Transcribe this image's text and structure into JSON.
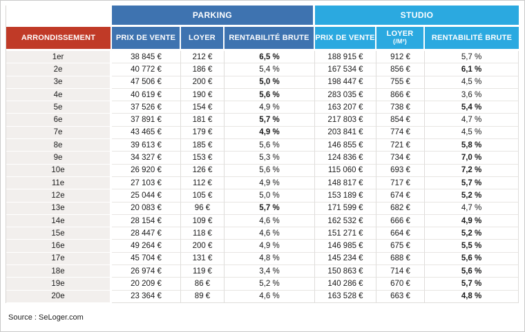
{
  "source": "Source : SeLoger.com",
  "colors": {
    "parking_header": "#3E73B0",
    "studio_header": "#2BA9E0",
    "arrondissement_header": "#C03A27",
    "row_label_background": "#F2EFED",
    "grid_line": "#DEDCDA",
    "text": "#1A1A1A"
  },
  "table": {
    "groups": {
      "parking": "PARKING",
      "studio": "STUDIO"
    },
    "headers": {
      "arrondissement": "ARRONDISSEMENT",
      "parking_prix": "PRIX DE VENTE",
      "parking_loyer": "LOYER",
      "parking_rent": "RENTABILITÉ BRUTE",
      "studio_prix": "PRIX DE VENTE",
      "studio_loyer_line1": "LOYER",
      "studio_loyer_line2": "(/M²)",
      "studio_rent": "RENTABILITÉ BRUTE"
    },
    "rows": [
      {
        "arr": "1er",
        "parking": {
          "prix": "38 845 €",
          "loyer": "212 €",
          "rent": "6,5 %",
          "rent_bold": true
        },
        "studio": {
          "prix": "188 915 €",
          "loyer": "912 €",
          "rent": "5,7 %",
          "rent_bold": false
        }
      },
      {
        "arr": "2e",
        "parking": {
          "prix": "40 772 €",
          "loyer": "186 €",
          "rent": "5,4 %",
          "rent_bold": false
        },
        "studio": {
          "prix": "167 534 €",
          "loyer": "856 €",
          "rent": "6,1 %",
          "rent_bold": true
        }
      },
      {
        "arr": "3e",
        "parking": {
          "prix": "47 506 €",
          "loyer": "200 €",
          "rent": "5,0 %",
          "rent_bold": true
        },
        "studio": {
          "prix": "198 447 €",
          "loyer": "755 €",
          "rent": "4,5 %",
          "rent_bold": false
        }
      },
      {
        "arr": "4e",
        "parking": {
          "prix": "40 619 €",
          "loyer": "190 €",
          "rent": "5,6 %",
          "rent_bold": true
        },
        "studio": {
          "prix": "283 035 €",
          "loyer": "866 €",
          "rent": "3,6 %",
          "rent_bold": false
        }
      },
      {
        "arr": "5e",
        "parking": {
          "prix": "37 526 €",
          "loyer": "154 €",
          "rent": "4,9 %",
          "rent_bold": false
        },
        "studio": {
          "prix": "163 207 €",
          "loyer": "738 €",
          "rent": "5,4 %",
          "rent_bold": true
        }
      },
      {
        "arr": "6e",
        "parking": {
          "prix": "37 891 €",
          "loyer": "181 €",
          "rent": "5,7 %",
          "rent_bold": true
        },
        "studio": {
          "prix": "217 803 €",
          "loyer": "854 €",
          "rent": "4,7 %",
          "rent_bold": false
        }
      },
      {
        "arr": "7e",
        "parking": {
          "prix": "43 465 €",
          "loyer": "179 €",
          "rent": "4,9 %",
          "rent_bold": true
        },
        "studio": {
          "prix": "203 841 €",
          "loyer": "774 €",
          "rent": "4,5 %",
          "rent_bold": false
        }
      },
      {
        "arr": "8e",
        "parking": {
          "prix": "39 613 €",
          "loyer": "185 €",
          "rent": "5,6 %",
          "rent_bold": false
        },
        "studio": {
          "prix": "146 855 €",
          "loyer": "721 €",
          "rent": "5,8 %",
          "rent_bold": true
        }
      },
      {
        "arr": "9e",
        "parking": {
          "prix": "34 327 €",
          "loyer": "153 €",
          "rent": "5,3 %",
          "rent_bold": false
        },
        "studio": {
          "prix": "124 836 €",
          "loyer": "734 €",
          "rent": "7,0 %",
          "rent_bold": true
        }
      },
      {
        "arr": "10e",
        "parking": {
          "prix": "26 920 €",
          "loyer": "126 €",
          "rent": "5,6 %",
          "rent_bold": false
        },
        "studio": {
          "prix": "115 060 €",
          "loyer": "693 €",
          "rent": "7,2 %",
          "rent_bold": true
        }
      },
      {
        "arr": "11e",
        "parking": {
          "prix": "27 103 €",
          "loyer": "112 €",
          "rent": "4,9 %",
          "rent_bold": false
        },
        "studio": {
          "prix": "148 817 €",
          "loyer": "717 €",
          "rent": "5,7 %",
          "rent_bold": true
        }
      },
      {
        "arr": "12e",
        "parking": {
          "prix": "25 044 €",
          "loyer": "105 €",
          "rent": "5,0 %",
          "rent_bold": false
        },
        "studio": {
          "prix": "153 189 €",
          "loyer": "674 €",
          "rent": "5,2 %",
          "rent_bold": true
        }
      },
      {
        "arr": "13e",
        "parking": {
          "prix": "20 083 €",
          "loyer": "96 €",
          "rent": "5,7 %",
          "rent_bold": true
        },
        "studio": {
          "prix": "171 599 €",
          "loyer": "682 €",
          "rent": "4,7 %",
          "rent_bold": false
        }
      },
      {
        "arr": "14e",
        "parking": {
          "prix": "28 154 €",
          "loyer": "109 €",
          "rent": "4,6 %",
          "rent_bold": false
        },
        "studio": {
          "prix": "162 532 €",
          "loyer": "666 €",
          "rent": "4,9 %",
          "rent_bold": true
        }
      },
      {
        "arr": "15e",
        "parking": {
          "prix": "28 447 €",
          "loyer": "118 €",
          "rent": "4,6 %",
          "rent_bold": false
        },
        "studio": {
          "prix": "151 271 €",
          "loyer": "664 €",
          "rent": "5,2 %",
          "rent_bold": true
        }
      },
      {
        "arr": "16e",
        "parking": {
          "prix": "49 264 €",
          "loyer": "200 €",
          "rent": "4,9 %",
          "rent_bold": false
        },
        "studio": {
          "prix": "146 985 €",
          "loyer": "675 €",
          "rent": "5,5 %",
          "rent_bold": true
        }
      },
      {
        "arr": "17e",
        "parking": {
          "prix": "45 704 €",
          "loyer": "131 €",
          "rent": "4,8 %",
          "rent_bold": false
        },
        "studio": {
          "prix": "145 234 €",
          "loyer": "688 €",
          "rent": "5,6 %",
          "rent_bold": true
        }
      },
      {
        "arr": "18e",
        "parking": {
          "prix": "26 974 €",
          "loyer": "119 €",
          "rent": "3,4 %",
          "rent_bold": false
        },
        "studio": {
          "prix": "150 863 €",
          "loyer": "714 €",
          "rent": "5,6 %",
          "rent_bold": true
        }
      },
      {
        "arr": "19e",
        "parking": {
          "prix": "20 209 €",
          "loyer": "86 €",
          "rent": "5,2 %",
          "rent_bold": false
        },
        "studio": {
          "prix": "140 286 €",
          "loyer": "670 €",
          "rent": "5,7 %",
          "rent_bold": true
        }
      },
      {
        "arr": "20e",
        "parking": {
          "prix": "23 364 €",
          "loyer": "89 €",
          "rent": "4,6 %",
          "rent_bold": false
        },
        "studio": {
          "prix": "163 528 €",
          "loyer": "663 €",
          "rent": "4,8 %",
          "rent_bold": true
        }
      }
    ]
  }
}
